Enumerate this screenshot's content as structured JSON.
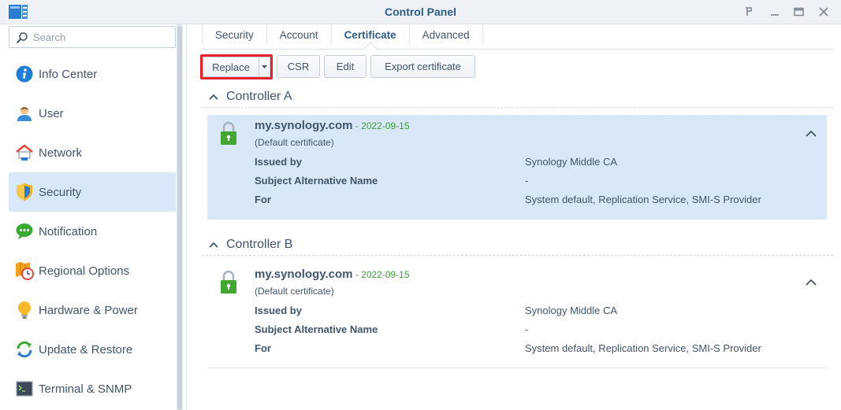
{
  "window": {
    "title": "Control Panel",
    "app_icon": "control-panel-icon",
    "help_glyph": "ᵖ",
    "minimize_glyph": "—",
    "maximize_glyph": "▭",
    "close_glyph": "✕"
  },
  "search": {
    "placeholder": "Search",
    "value": ""
  },
  "sidebar": {
    "items": [
      {
        "label": "Info Center",
        "icon": "info-icon"
      },
      {
        "label": "User",
        "icon": "user-icon"
      },
      {
        "label": "Network",
        "icon": "network-icon"
      },
      {
        "label": "Security",
        "icon": "shield-icon",
        "active": true
      },
      {
        "label": "Notification",
        "icon": "chat-bubble-icon"
      },
      {
        "label": "Regional Options",
        "icon": "map-clock-icon"
      },
      {
        "label": "Hardware & Power",
        "icon": "lightbulb-icon"
      },
      {
        "label": "Update & Restore",
        "icon": "refresh-icon"
      },
      {
        "label": "Terminal & SNMP",
        "icon": "terminal-icon"
      }
    ]
  },
  "tabs": [
    {
      "label": "Security"
    },
    {
      "label": "Account"
    },
    {
      "label": "Certificate",
      "active": true
    },
    {
      "label": "Advanced"
    }
  ],
  "toolbar": {
    "replace_label": "Replace",
    "csr_label": "CSR",
    "edit_label": "Edit",
    "export_label": "Export certificate"
  },
  "controllers": [
    {
      "title": "Controller A",
      "cert": {
        "name": "my.synology.com",
        "date": " - 2022-09-15",
        "subtitle": "(Default certificate)",
        "rows": [
          {
            "label": "Issued by",
            "value": "Synology Middle CA"
          },
          {
            "label": "Subject Alternative Name",
            "value": "-"
          },
          {
            "label": "For",
            "value": "System default, Replication Service, SMI-S Provider"
          }
        ]
      }
    },
    {
      "title": "Controller B",
      "cert": {
        "name": "my.synology.com",
        "date": " - 2022-09-15",
        "subtitle": "(Default certificate)",
        "rows": [
          {
            "label": "Issued by",
            "value": "Synology Middle CA"
          },
          {
            "label": "Subject Alternative Name",
            "value": "-"
          },
          {
            "label": "For",
            "value": "System default, Replication Service, SMI-S Provider"
          }
        ]
      }
    }
  ],
  "colors": {
    "accent": "#2b5c8a",
    "selection": "#d9e8f8",
    "highlight_border": "#e8212c",
    "lock_green": "#43a630",
    "date_green": "#3f9a3a"
  }
}
